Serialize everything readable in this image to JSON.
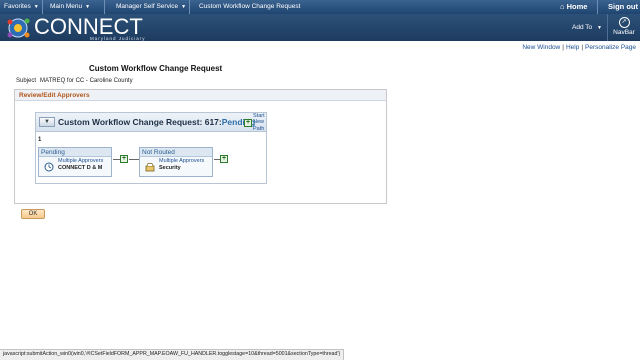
{
  "topbar": {
    "menus": [
      {
        "label": "Favorites"
      },
      {
        "label": "Main Menu"
      },
      {
        "label": "Manager Self Service"
      }
    ],
    "breadcrumb_current": "Custom Workflow Change Request",
    "home_label": "Home",
    "signout_label": "Sign out"
  },
  "header": {
    "brand": "CONNECT",
    "brand_sub": "Maryland Judiciary",
    "addto_label": "Add To",
    "navbar_label": "NavBar"
  },
  "links": {
    "new_window": "New Window",
    "help": "Help",
    "personalize": "Personalize Page"
  },
  "page": {
    "title": "Custom Workflow Change Request",
    "subject_label": "Subject",
    "subject_value": "MATREQ for CC - Caroline County"
  },
  "panel": {
    "header": "Review/Edit Approvers"
  },
  "workflow": {
    "title": "Custom Workflow Change Request: 617:",
    "status": "Pending",
    "start_new_path": [
      "Start",
      "New",
      "Path"
    ],
    "stage_number": "1",
    "steps": [
      {
        "status": "Pending",
        "approvers": "Multiple Approvers",
        "role": "CONNECT D & M",
        "icon": "clock-icon"
      },
      {
        "status": "Not Routed",
        "approvers": "Multiple Approvers",
        "role": "Security",
        "icon": "inbox-icon"
      }
    ]
  },
  "buttons": {
    "ok": "OK"
  },
  "statusbar": {
    "text": "javascript:submitAction_win0(win0,'#ICSetFieldFORM_APPR_MAP.EOAW_FU_HANDLER.togglestage=10&thread=5001&sectionType=thread')"
  },
  "colors": {
    "header_bg": "#1d3b5f",
    "panel_title": "#b3561a",
    "status_link": "#2a6ea8",
    "ok_button": "#f5c98c"
  }
}
